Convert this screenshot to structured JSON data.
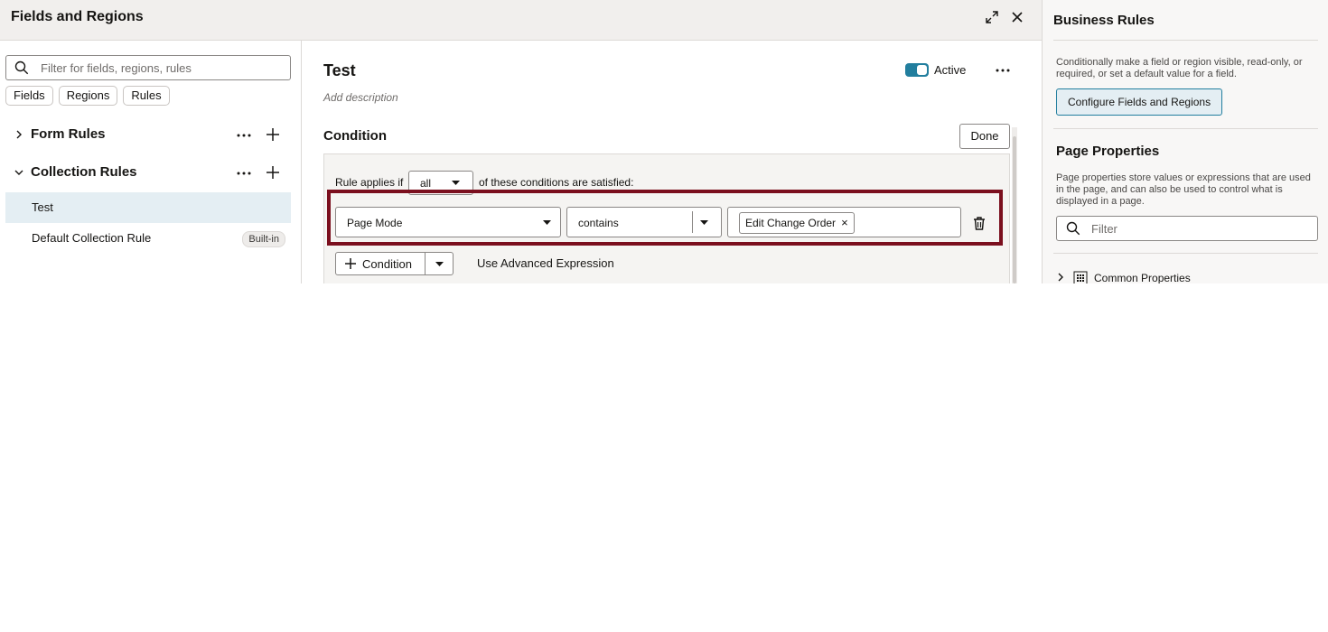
{
  "modal": {
    "title": "Fields and Regions"
  },
  "left": {
    "search_placeholder": "Filter for fields, regions, rules",
    "chips": [
      "Fields",
      "Regions",
      "Rules"
    ],
    "form_rules_label": "Form Rules",
    "collection_rules_label": "Collection Rules",
    "items": [
      {
        "label": "Test",
        "selected": true
      },
      {
        "label": "Default Collection Rule",
        "badge": "Built-in"
      }
    ]
  },
  "rule": {
    "title": "Test",
    "description_placeholder": "Add description",
    "status_label": "Active",
    "active": true
  },
  "condition": {
    "title": "Condition",
    "done_label": "Done",
    "applies_prefix": "Rule applies if",
    "applies_value": "all",
    "applies_suffix": "of these conditions are satisfied:",
    "field": "Page Mode",
    "operator": "contains",
    "value_tag": "Edit Change Order",
    "add_condition_label": "Condition",
    "advanced_label": "Use Advanced Expression"
  },
  "right": {
    "business_rules_title": "Business Rules",
    "business_rules_desc": "Conditionally make a field or region visible, read-only, or required, or set a default value for a field.",
    "configure_label": "Configure Fields and Regions",
    "page_props_title": "Page Properties",
    "page_props_desc": "Page properties store values or expressions that are used in the page, and can also be used to control what is displayed in a page.",
    "filter_placeholder": "Filter",
    "common_props_label": "Common Properties"
  },
  "colors": {
    "accent": "#227e9e",
    "highlight": "#7b0f1e",
    "selected_row": "#e4eef3"
  }
}
